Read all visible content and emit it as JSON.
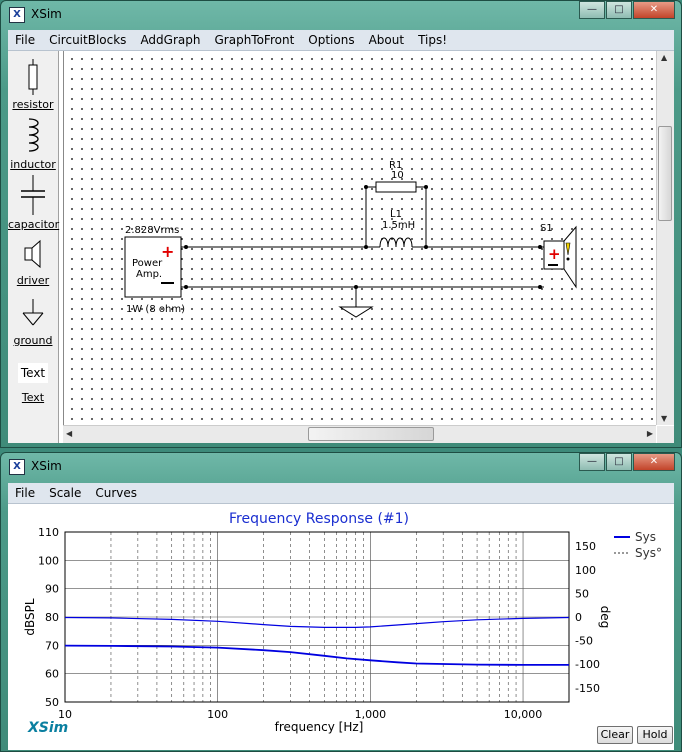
{
  "schematic_window": {
    "title": "XSim",
    "menu": [
      "File",
      "CircuitBlocks",
      "AddGraph",
      "GraphToFront",
      "Options",
      "About",
      "Tips!"
    ],
    "tools": [
      {
        "label": "resistor",
        "icon": "resistor-icon"
      },
      {
        "label": "inductor",
        "icon": "inductor-icon"
      },
      {
        "label": "capacitor",
        "icon": "capacitor-icon"
      },
      {
        "label": "driver",
        "icon": "speaker-icon"
      },
      {
        "label": "ground",
        "icon": "ground-icon"
      },
      {
        "label": "Text",
        "icon": "text-icon"
      }
    ],
    "text_tool_preview": "Text",
    "circuit": {
      "amp_voltage": "2.828Vrms",
      "amp_label_line1": "Power",
      "amp_label_line2": "Amp.",
      "amp_power": "1W (8 ohm)",
      "r1_name": "R1",
      "r1_value": "10",
      "l1_name": "L1",
      "l1_value": "1.5mH",
      "speaker_name": "S1"
    }
  },
  "graph_window": {
    "title": "XSim",
    "menu": [
      "File",
      "Scale",
      "Curves"
    ],
    "brand": "XSim",
    "clear_label": "Clear",
    "hold_label": "Hold"
  },
  "chart_data": {
    "type": "line",
    "title": "Frequency Response (#1)",
    "xlabel": "frequency [Hz]",
    "ylabel": "dBSPL",
    "y2label": "deg",
    "xscale": "log",
    "xlim": [
      10,
      20000
    ],
    "ylim": [
      50,
      110
    ],
    "y2lim": [
      -180,
      180
    ],
    "x_ticks": [
      "10",
      "100",
      "1,000",
      "10,000"
    ],
    "y_ticks": [
      "110",
      "100",
      "90",
      "80",
      "70",
      "60",
      "50"
    ],
    "y2_ticks": [
      "150",
      "100",
      "50",
      "0",
      "-50",
      "-100",
      "-150"
    ],
    "legend_position": "top-right",
    "grid": true,
    "series": [
      {
        "name": "Sys",
        "axis": "left",
        "style": "solid",
        "color": "#0000e0",
        "x": [
          10,
          20,
          50,
          100,
          200,
          300,
          500,
          700,
          1000,
          1500,
          2000,
          3000,
          5000,
          10000,
          20000
        ],
        "y": [
          69.9,
          69.8,
          69.6,
          69.2,
          68.3,
          67.6,
          66.3,
          65.4,
          64.7,
          64.0,
          63.6,
          63.4,
          63.2,
          63.1,
          63.1
        ]
      },
      {
        "name": "Sys°",
        "axis": "right",
        "style": "solid",
        "color": "#0000e0",
        "x": [
          10,
          20,
          50,
          100,
          200,
          300,
          500,
          700,
          800,
          1000,
          1500,
          2000,
          3000,
          5000,
          10000,
          20000
        ],
        "y": [
          -1,
          -2,
          -5,
          -9,
          -16,
          -20,
          -22,
          -22,
          -22,
          -21,
          -17,
          -14,
          -10,
          -6,
          -3,
          -1
        ]
      }
    ]
  }
}
